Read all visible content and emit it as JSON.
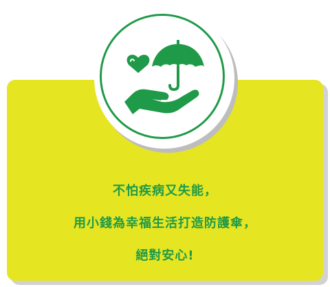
{
  "colors": {
    "card": "#e6e522",
    "accent_green": "#1f9a48",
    "badge_background": "#ffffff"
  },
  "badge": {
    "icon": "hand-holding-heart-and-umbrella-icon"
  },
  "caption": {
    "lines": [
      "不怕疾病又失能，",
      "用小錢為幸福生活打造防護傘，",
      "絕對安心!"
    ]
  }
}
